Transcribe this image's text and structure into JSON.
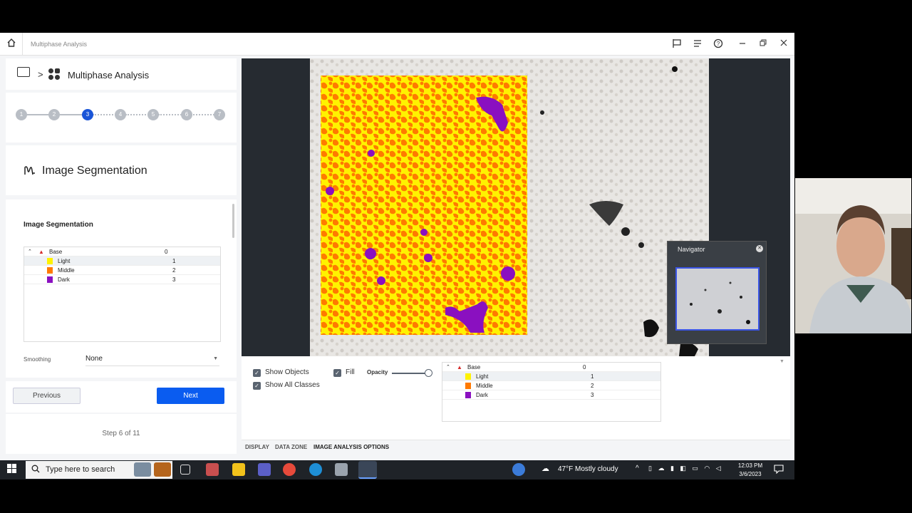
{
  "titlebar": {
    "title": "Multiphase Analysis",
    "icons": [
      "home-icon",
      "flag-icon",
      "list-icon",
      "help-icon",
      "minimize-icon",
      "restore-icon",
      "close-icon"
    ]
  },
  "breadcrumb": {
    "separator": ">",
    "label": "Multiphase Analysis"
  },
  "stepper": {
    "steps": [
      "1",
      "2",
      "3",
      "4",
      "5",
      "6",
      "7"
    ],
    "active": 3
  },
  "section": {
    "title": "Image Segmentation"
  },
  "segmentation": {
    "heading": "Image Segmentation",
    "classes": [
      {
        "name": "Base",
        "value": "0",
        "color": "#d62e2e"
      },
      {
        "name": "Light",
        "value": "1",
        "color": "#fff200"
      },
      {
        "name": "Middle",
        "value": "2",
        "color": "#ff7a00"
      },
      {
        "name": "Dark",
        "value": "3",
        "color": "#8a10c0"
      }
    ],
    "smoothing_label": "Smoothing",
    "smoothing_value": "None"
  },
  "nav": {
    "previous": "Previous",
    "next": "Next",
    "step_text": "Step 6 of 11"
  },
  "options": {
    "show_objects": "Show Objects",
    "show_all_classes": "Show All Classes",
    "fill": "Fill",
    "opacity": "Opacity",
    "opacity_value": 1.0
  },
  "tabs": [
    "DISPLAY",
    "DATA ZONE",
    "IMAGE ANALYSIS OPTIONS"
  ],
  "navigator": {
    "title": "Navigator"
  },
  "taskbar": {
    "search_placeholder": "Type here to search",
    "weather": "47°F  Mostly cloudy",
    "time": "12:03 PM",
    "date": "3/6/2023"
  },
  "colors": {
    "accent": "#0a5cf0",
    "light": "#fff200",
    "middle": "#ff7a00",
    "dark": "#8a10c0"
  }
}
